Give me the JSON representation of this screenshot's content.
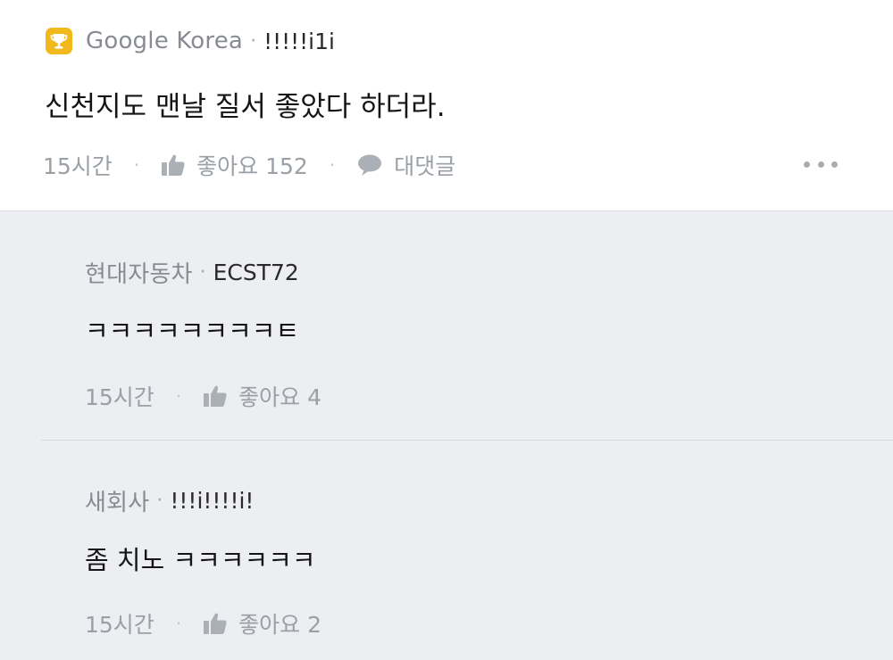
{
  "main_comment": {
    "company": "Google Korea",
    "username": "!!!!!i1i",
    "content": "신천지도 맨날 질서 좋았다 하더라.",
    "time": "15시간",
    "like_label": "좋아요 152",
    "reply_label": "대댓글",
    "badge_icon": "trophy-icon",
    "badge_color": "#f2b91c"
  },
  "replies": [
    {
      "company": "현대자동차",
      "username": "ECST72",
      "content": "ㅋㅋㅋㅋㅋㅋㅋㅋㅌ",
      "time": "15시간",
      "like_label": "좋아요 4"
    },
    {
      "company": "새회사",
      "username": "!!!i!!!!i!",
      "content": "좀 치노 ㅋㅋㅋㅋㅋㅋ",
      "time": "15시간",
      "like_label": "좋아요 2"
    }
  ],
  "separator": "·",
  "icons": {
    "like": "thumbs-up-icon",
    "reply": "speech-bubble-icon",
    "more": "more-options-icon"
  }
}
